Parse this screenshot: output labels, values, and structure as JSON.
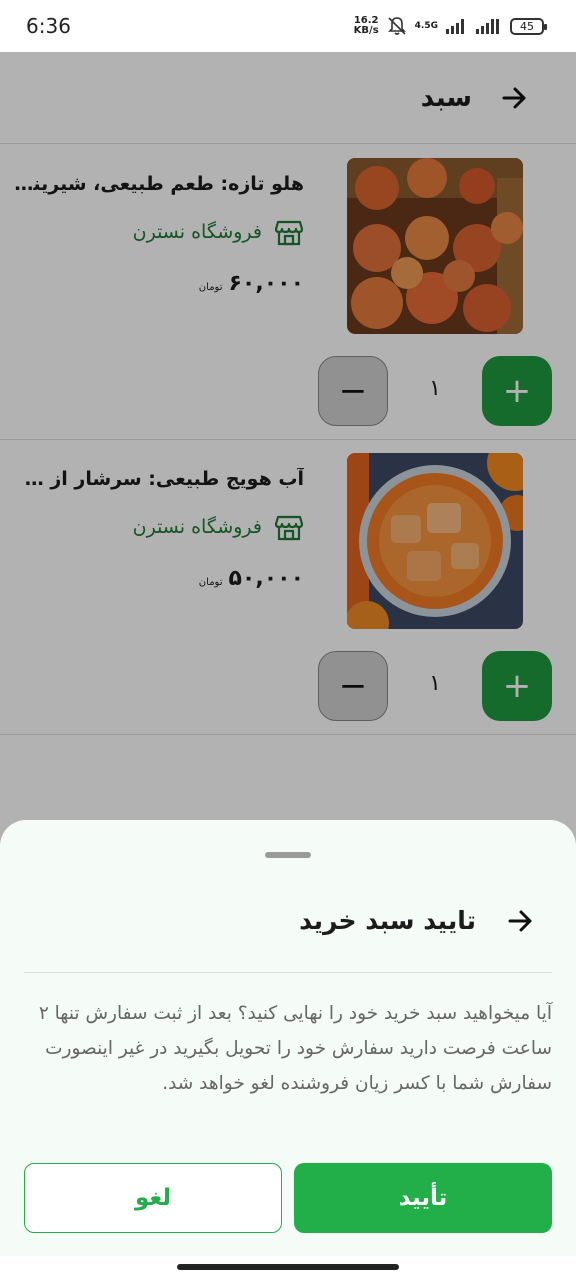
{
  "status_bar": {
    "time": "6:36",
    "net_speed_value": "16.2",
    "net_speed_unit": "KB/s",
    "network": "4.5G",
    "battery": "45"
  },
  "header": {
    "title": "سبد"
  },
  "cart": {
    "items": [
      {
        "name": "هلو تازه: طعم طبیعی، شیرینی ...",
        "store": "فروشگاه نسترن",
        "price": "۶۰,۰۰۰",
        "currency": "تومان",
        "quantity": "۱"
      },
      {
        "name": "آب هویج طبیعی: سرشار از سلام...",
        "store": "فروشگاه نسترن",
        "price": "۵۰,۰۰۰",
        "currency": "تومان",
        "quantity": "۱"
      }
    ],
    "plus_label": "+",
    "minus_label": "−"
  },
  "sheet": {
    "title": "تایید سبد خرید",
    "message": "آیا میخواهید سبد خرید خود را نهایی کنید؟ بعد از ثبت سفارش تنها ۲ ساعت فرصت دارید سفارش خود را تحویل بگیرید در غیر اینصورت سفارش شما با کسر زیان فروشنده لغو خواهد شد.",
    "confirm_label": "تأیید",
    "cancel_label": "لغو"
  },
  "colors": {
    "brand_green": "#22ae49",
    "store_green": "#1e7a33"
  }
}
